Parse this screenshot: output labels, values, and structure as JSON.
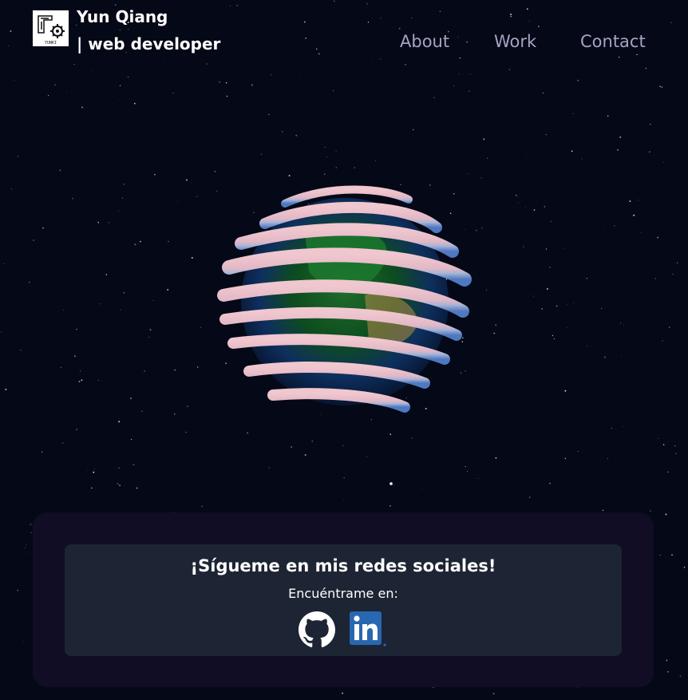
{
  "header": {
    "logo_text": "YUNKI",
    "name": "Yun Qiang",
    "role": "| web developer",
    "nav": [
      {
        "label": "About"
      },
      {
        "label": "Work"
      },
      {
        "label": "Contact"
      }
    ]
  },
  "hero": {
    "model": "globe-icon"
  },
  "social": {
    "title": "¡Sígueme en mis redes sociales!",
    "subtitle": "Encuéntrame en:",
    "links": [
      {
        "icon": "github-icon"
      },
      {
        "icon": "linkedin-icon"
      }
    ]
  },
  "colors": {
    "background": "#050816",
    "nav_text": "#a7a3c5",
    "outer_card": "#100d25",
    "inner_card": "#1d2433",
    "linkedin_blue": "#2867b2"
  }
}
